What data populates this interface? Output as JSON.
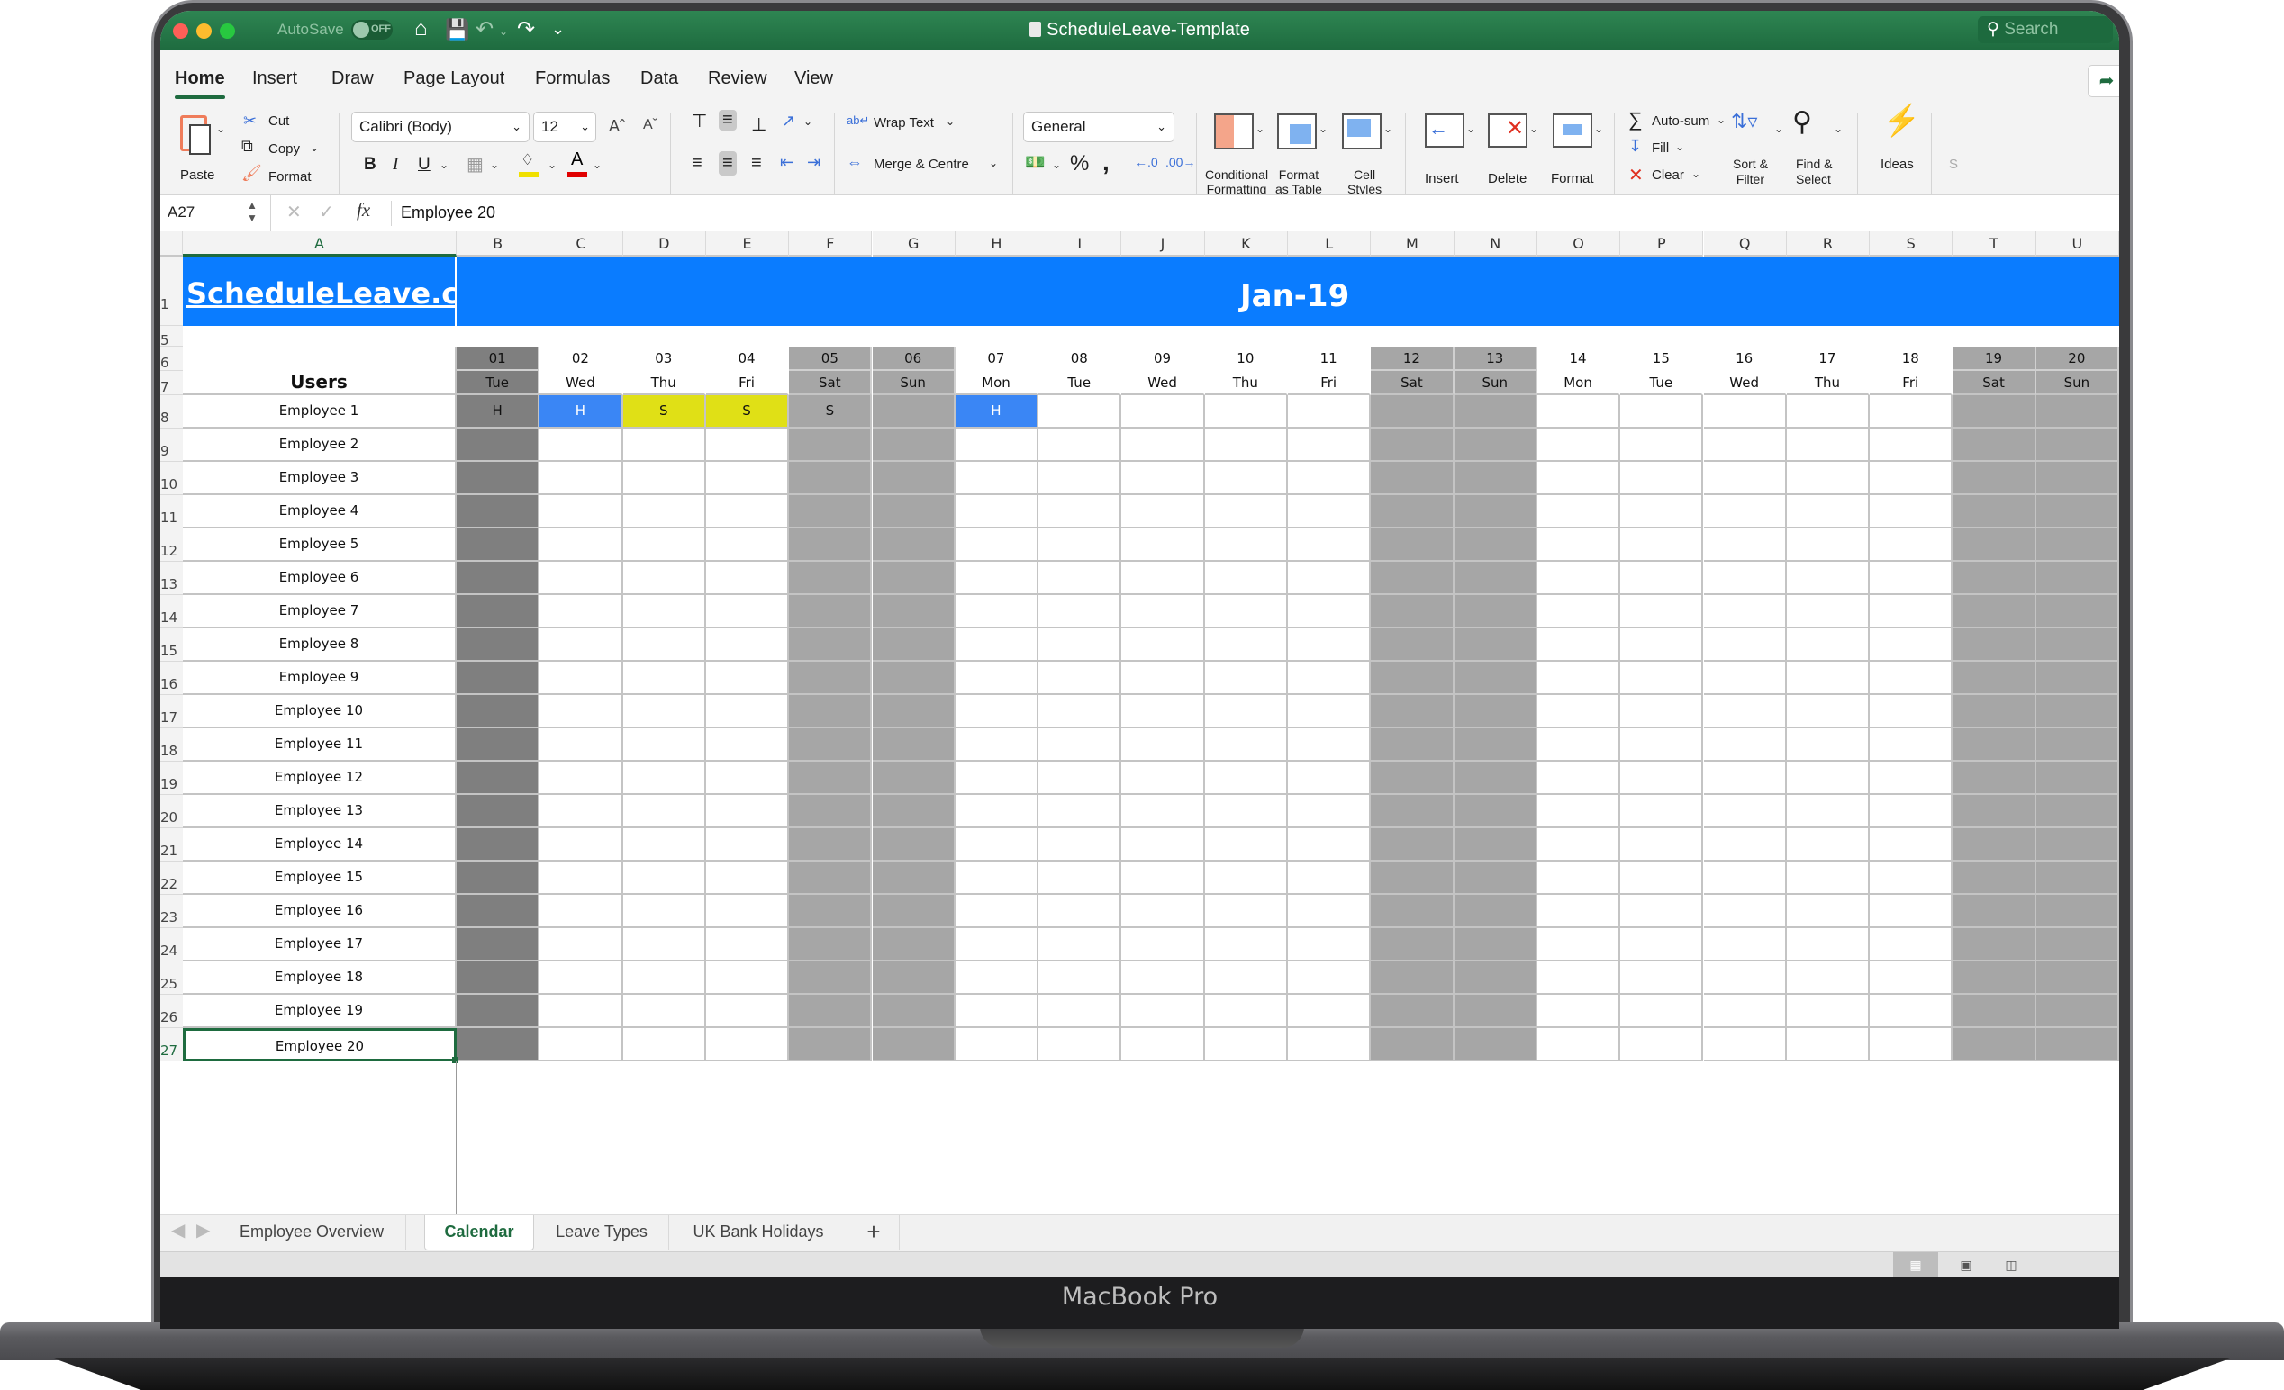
{
  "window": {
    "title": "ScheduleLeave-Template",
    "autosave_label": "AutoSave",
    "autosave_state": "OFF",
    "search_placeholder": "Search",
    "traffic_lights": {
      "close": "#fe5f57",
      "minimize": "#febc2e",
      "maximize": "#28c840"
    }
  },
  "ribbon_tabs": [
    {
      "label": "Home",
      "active": true
    },
    {
      "label": "Insert"
    },
    {
      "label": "Draw"
    },
    {
      "label": "Page Layout"
    },
    {
      "label": "Formulas"
    },
    {
      "label": "Data"
    },
    {
      "label": "Review"
    },
    {
      "label": "View"
    }
  ],
  "ribbon": {
    "clipboard": {
      "paste": "Paste",
      "cut": "Cut",
      "copy": "Copy",
      "format": "Format"
    },
    "font": {
      "name": "Calibri (Body)",
      "size": "12",
      "bold": "B",
      "italic": "I",
      "underline": "U",
      "fill_color": "#f0e000",
      "font_color": "#e00000"
    },
    "alignment": {
      "wrap_text": "Wrap Text",
      "merge_centre": "Merge & Centre"
    },
    "number": {
      "format": "General",
      "percent": "%",
      "comma": ","
    },
    "styles": {
      "conditional_formatting": [
        "Conditional",
        "Formatting"
      ],
      "format_as_table": [
        "Format",
        "as Table"
      ],
      "cell_styles": [
        "Cell",
        "Styles"
      ]
    },
    "cells": {
      "insert": "Insert",
      "delete": "Delete",
      "format": "Format"
    },
    "editing": {
      "autosum": "Auto-sum",
      "fill": "Fill",
      "clear": "Clear",
      "sort_filter": [
        "Sort &",
        "Filter"
      ],
      "find_select": [
        "Find &",
        "Select"
      ]
    },
    "ideas": "Ideas",
    "sensitivity_partial": "S"
  },
  "formula_bar": {
    "name_box": "A27",
    "fx": "fx",
    "content": "Employee 20"
  },
  "sheet": {
    "brand": "ScheduleLeave.com",
    "month": "Jan-19",
    "users_header": "Users",
    "column_letters": [
      "A",
      "B",
      "C",
      "D",
      "E",
      "F",
      "G",
      "H",
      "I",
      "J",
      "K",
      "L",
      "M",
      "N",
      "O",
      "P",
      "Q",
      "R",
      "S",
      "T",
      "U"
    ],
    "row_numbers": [
      "1",
      "5",
      "6",
      "7",
      "8",
      "9",
      "10",
      "11",
      "12",
      "13",
      "14",
      "15",
      "16",
      "17",
      "18",
      "19",
      "20",
      "21",
      "22",
      "23",
      "24",
      "25",
      "26",
      "27"
    ],
    "days": [
      {
        "date": "01",
        "dow": "Tue",
        "type": "holiday"
      },
      {
        "date": "02",
        "dow": "Wed",
        "type": "work"
      },
      {
        "date": "03",
        "dow": "Thu",
        "type": "work"
      },
      {
        "date": "04",
        "dow": "Fri",
        "type": "work"
      },
      {
        "date": "05",
        "dow": "Sat",
        "type": "weekend"
      },
      {
        "date": "06",
        "dow": "Sun",
        "type": "weekend"
      },
      {
        "date": "07",
        "dow": "Mon",
        "type": "work"
      },
      {
        "date": "08",
        "dow": "Tue",
        "type": "work"
      },
      {
        "date": "09",
        "dow": "Wed",
        "type": "work"
      },
      {
        "date": "10",
        "dow": "Thu",
        "type": "work"
      },
      {
        "date": "11",
        "dow": "Fri",
        "type": "work"
      },
      {
        "date": "12",
        "dow": "Sat",
        "type": "weekend"
      },
      {
        "date": "13",
        "dow": "Sun",
        "type": "weekend"
      },
      {
        "date": "14",
        "dow": "Mon",
        "type": "work"
      },
      {
        "date": "15",
        "dow": "Tue",
        "type": "work"
      },
      {
        "date": "16",
        "dow": "Wed",
        "type": "work"
      },
      {
        "date": "17",
        "dow": "Thu",
        "type": "work"
      },
      {
        "date": "18",
        "dow": "Fri",
        "type": "work"
      },
      {
        "date": "19",
        "dow": "Sat",
        "type": "weekend"
      },
      {
        "date": "20",
        "dow": "Sun",
        "type": "weekend"
      }
    ],
    "employees": [
      "Employee 1",
      "Employee 2",
      "Employee 3",
      "Employee 4",
      "Employee 5",
      "Employee 6",
      "Employee 7",
      "Employee 8",
      "Employee 9",
      "Employee 10",
      "Employee 11",
      "Employee 12",
      "Employee 13",
      "Employee 14",
      "Employee 15",
      "Employee 16",
      "Employee 17",
      "Employee 18",
      "Employee 19",
      "Employee 20"
    ],
    "leave_entries": [
      {
        "employee": 0,
        "day": 0,
        "code": "H",
        "color": "#7f7f7f",
        "text_color": "#111111"
      },
      {
        "employee": 0,
        "day": 1,
        "code": "H",
        "color": "#3a86f5",
        "text_color": "#ffffff"
      },
      {
        "employee": 0,
        "day": 2,
        "code": "S",
        "color": "#e0e016",
        "text_color": "#111111"
      },
      {
        "employee": 0,
        "day": 3,
        "code": "S",
        "color": "#e0e016",
        "text_color": "#111111"
      },
      {
        "employee": 0,
        "day": 4,
        "code": "S",
        "color": "#a6a6a6",
        "text_color": "#111111"
      },
      {
        "employee": 0,
        "day": 6,
        "code": "H",
        "color": "#3a86f5",
        "text_color": "#ffffff"
      }
    ],
    "colors": {
      "header_band": "#0a7cff",
      "weekend": "#a6a6a6",
      "holiday": "#7f7f7f",
      "work": "#ffffff",
      "selection": "#1e6b3f"
    },
    "selected_cell": "A27"
  },
  "sheet_tabs": [
    {
      "label": "Employee Overview"
    },
    {
      "label": "Calendar",
      "active": true
    },
    {
      "label": "Leave Types"
    },
    {
      "label": "UK Bank Holidays"
    }
  ],
  "add_sheet": "+",
  "device_label": "MacBook Pro"
}
